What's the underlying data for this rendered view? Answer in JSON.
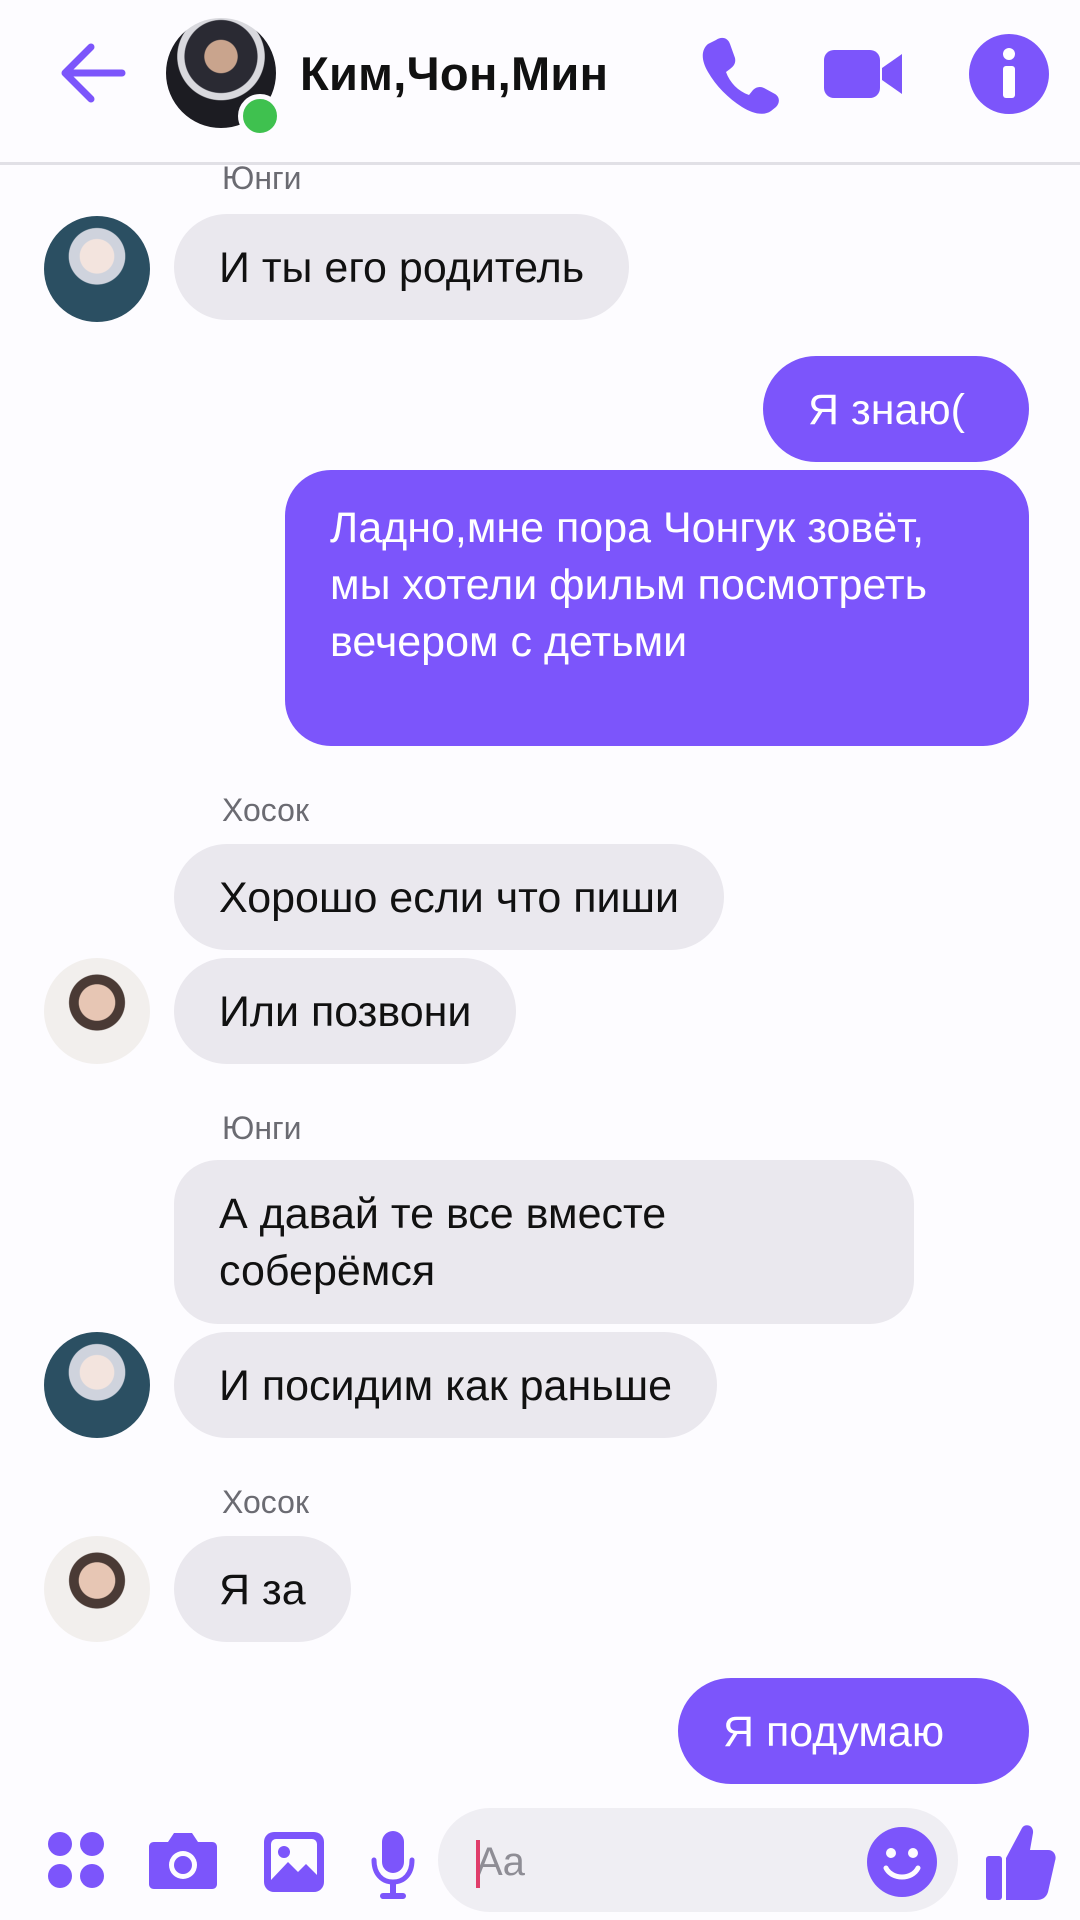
{
  "header": {
    "title": "Ким,Чон,Мин",
    "accent": "#7c55fb",
    "online_color": "#3fc14f"
  },
  "messages": [
    {
      "type": "sender",
      "text": "Юнги"
    },
    {
      "type": "in",
      "text": "И ты его родитель"
    },
    {
      "type": "out",
      "text": "Я знаю("
    },
    {
      "type": "out",
      "text": "Ладно,мне пора Чонгук зовёт, мы хотели фильм посмотреть вечером с детьми"
    },
    {
      "type": "sender",
      "text": "Хосок"
    },
    {
      "type": "in",
      "text": "Хорошо если что пиши"
    },
    {
      "type": "in",
      "text": "Или позвони"
    },
    {
      "type": "sender",
      "text": "Юнги"
    },
    {
      "type": "in",
      "text": "А давай те все вместе соберёмся"
    },
    {
      "type": "in",
      "text": "И посидим как раньше"
    },
    {
      "type": "sender",
      "text": "Хосок"
    },
    {
      "type": "in",
      "text": "Я за"
    },
    {
      "type": "out",
      "text": "Я подумаю"
    }
  ],
  "composer": {
    "placeholder": "Aa",
    "icons": [
      "apps-icon",
      "camera-icon",
      "gallery-icon",
      "microphone-icon",
      "emoji-icon",
      "thumbs-up-icon"
    ]
  },
  "colors": {
    "accent": "#7c55fb",
    "incoming_bubble": "#eae8ee",
    "background": "#fdfcff"
  }
}
